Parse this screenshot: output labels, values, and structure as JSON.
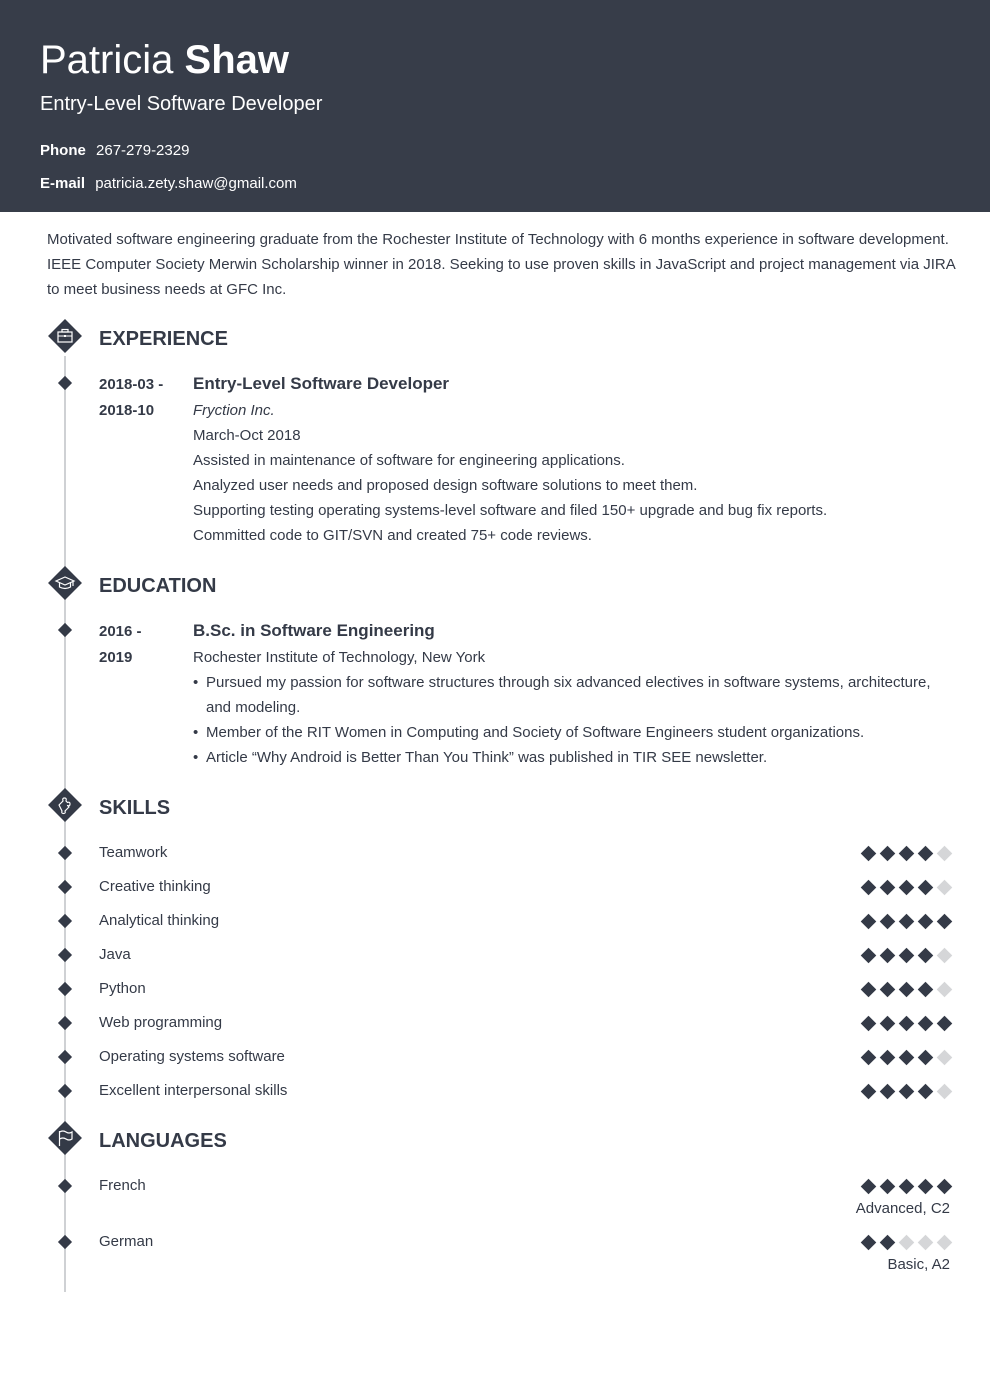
{
  "header": {
    "first_name": "Patricia",
    "last_name": "Shaw",
    "title": "Entry-Level Software Developer",
    "phone_label": "Phone",
    "phone": "267-279-2329",
    "email_label": "E-mail",
    "email": "patricia.zety.shaw@gmail.com"
  },
  "summary": "Motivated software engineering graduate from the Rochester Institute of Technology with 6 months experience in software development. IEEE Computer Society Merwin Scholarship winner in 2018. Seeking to use proven skills in JavaScript and project management via JIRA to meet business needs at GFC Inc.",
  "colors": {
    "header_bg": "#373d49",
    "accent": "#343a47",
    "inactive": "#d5d6d8",
    "timeline": "#cfd1d4"
  },
  "experience": {
    "heading": "EXPERIENCE",
    "icon": "briefcase-icon",
    "items": [
      {
        "date_start": "2018-03 -",
        "date_end": "2018-10",
        "title": "Entry-Level Software Developer",
        "company": "Fryction Inc.",
        "period": "March-Oct 2018",
        "lines": [
          "Assisted in maintenance of software for engineering applications.",
          "Analyzed user needs and proposed design software solutions to meet them.",
          "Supporting testing operating systems-level software and filed 150+ upgrade and bug fix reports.",
          "Committed code to GIT/SVN and created 75+ code reviews."
        ]
      }
    ]
  },
  "education": {
    "heading": "EDUCATION",
    "icon": "graduation-cap-icon",
    "items": [
      {
        "date_start": "2016 -",
        "date_end": "2019",
        "degree": "B.Sc. in Software Engineering",
        "school": "Rochester Institute of Technology, New York",
        "bullets": [
          "Pursued my passion for software structures through six advanced electives in software systems, architecture, and modeling.",
          "Member of the RIT Women in Computing and Society of Software Engineers student organizations.",
          "Article “Why Android is Better Than You Think” was published in TIR SEE newsletter."
        ]
      }
    ]
  },
  "skills": {
    "heading": "SKILLS",
    "icon": "puzzle-icon",
    "max": 5,
    "items": [
      {
        "name": "Teamwork",
        "level": 4
      },
      {
        "name": "Creative thinking",
        "level": 4
      },
      {
        "name": "Analytical thinking",
        "level": 5
      },
      {
        "name": "Java",
        "level": 4
      },
      {
        "name": "Python",
        "level": 4
      },
      {
        "name": "Web programming",
        "level": 5
      },
      {
        "name": "Operating systems software",
        "level": 4
      },
      {
        "name": "Excellent interpersonal skills",
        "level": 4
      }
    ]
  },
  "languages": {
    "heading": "LANGUAGES",
    "icon": "flag-icon",
    "max": 5,
    "items": [
      {
        "name": "French",
        "level": 5,
        "label": "Advanced, C2"
      },
      {
        "name": "German",
        "level": 2,
        "label": "Basic, A2"
      }
    ]
  }
}
